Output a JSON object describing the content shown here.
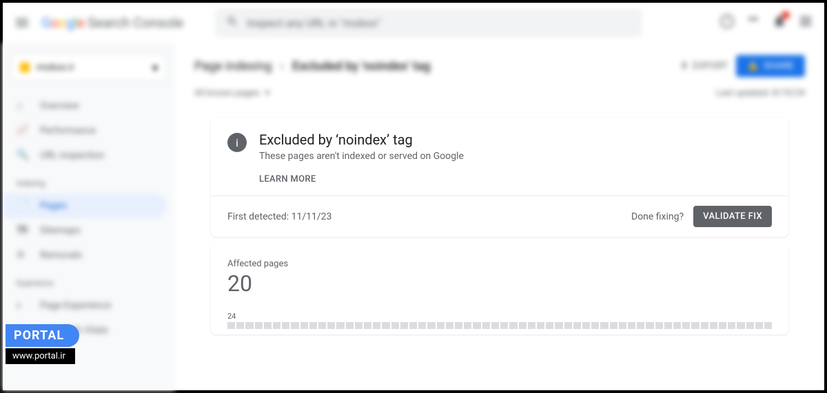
{
  "header": {
    "app_name": "Search Console",
    "search_placeholder": "Inspect any URL in \"mobox\""
  },
  "sidebar": {
    "property": "mobox.ir",
    "items": [
      {
        "label": "Overview",
        "icon": "home"
      },
      {
        "label": "Performance",
        "icon": "trending"
      },
      {
        "label": "URL inspection",
        "icon": "search"
      }
    ],
    "section_indexing": "Indexing",
    "indexing_items": [
      {
        "label": "Pages",
        "icon": "file",
        "active": true
      },
      {
        "label": "Sitemaps",
        "icon": "sitemap"
      },
      {
        "label": "Removals",
        "icon": "block"
      }
    ],
    "section_experience": "Experience",
    "experience_items": [
      {
        "label": "Page Experience",
        "icon": "gauge"
      },
      {
        "label": "Core Web Vitals",
        "icon": "vitals"
      }
    ]
  },
  "breadcrumb": {
    "a": "Page indexing",
    "b": "Excluded by 'noindex' tag"
  },
  "top_actions": {
    "export": "EXPORT",
    "share": "SHARE"
  },
  "filter": {
    "label": "All known pages",
    "last_updated": "Last updated: 8/10/24"
  },
  "card": {
    "title": "Excluded by ‘noindex’ tag",
    "subtitle": "These pages aren't indexed or served on Google",
    "learn_more": "LEARN MORE",
    "first_detected_label": "First detected:",
    "first_detected_date": "11/11/23",
    "done_fixing": "Done fixing?",
    "validate": "VALIDATE FIX"
  },
  "affected": {
    "label": "Affected pages",
    "count": "20",
    "y_tick": "24"
  },
  "watermark": {
    "badge": "PORTAL",
    "url": "www.portal.ir"
  },
  "chart_data": {
    "type": "bar",
    "title": "Affected pages",
    "ylim": [
      0,
      24
    ],
    "values_note": "Individual bar values not labeled; approximately 60 equal-height grey bars visible at bottom edge of viewport, each roughly at minimal non-zero height.",
    "approx_bar_count": 60
  }
}
